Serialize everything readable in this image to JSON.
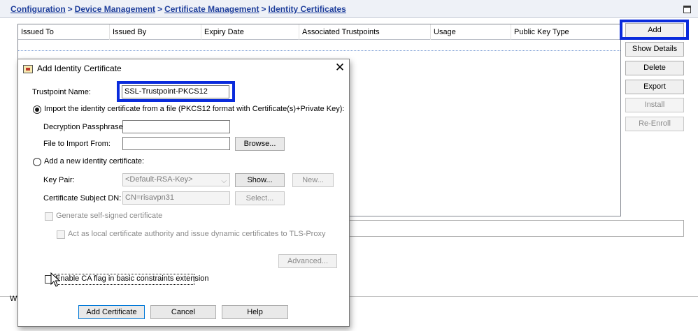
{
  "breadcrumb": {
    "items": [
      "Configuration",
      "Device Management",
      "Certificate Management",
      "Identity Certificates"
    ],
    "separator": ">"
  },
  "table": {
    "columns": [
      "Issued To",
      "Issued By",
      "Expiry Date",
      "Associated Trustpoints",
      "Usage",
      "Public Key Type"
    ]
  },
  "side_buttons": {
    "add": "Add",
    "show_details": "Show Details",
    "delete": "Delete",
    "export": "Export",
    "install": "Install",
    "re_enroll": "Re-Enroll"
  },
  "background": {
    "left_strip_text": "W"
  },
  "dialog": {
    "title": "Add Identity Certificate",
    "close_glyph": "✕",
    "trustpoint_label": "Trustpoint Name:",
    "trustpoint_value": "SSL-Trustpoint-PKCS12",
    "import_option": "Import the identity certificate from a file (PKCS12 format with Certificate(s)+Private Key):",
    "decryption_label": "Decryption Passphrase:",
    "decryption_value": "",
    "file_label": "File to Import From:",
    "file_value": "",
    "browse": "Browse...",
    "new_option": "Add a new identity certificate:",
    "key_pair_label": "Key Pair:",
    "key_pair_value": "<Default-RSA-Key>",
    "show": "Show...",
    "new": "New...",
    "subject_label": "Certificate Subject DN:",
    "subject_value": "CN=risavpn31",
    "select": "Select...",
    "self_signed": "Generate self-signed certificate",
    "local_ca": "Act as local certificate authority and issue dynamic certificates to TLS-Proxy",
    "advanced": "Advanced...",
    "ca_flag": "Enable CA flag in basic constraints extension",
    "add_certificate": "Add Certificate",
    "cancel": "Cancel",
    "help": "Help",
    "selected_option": "import"
  }
}
